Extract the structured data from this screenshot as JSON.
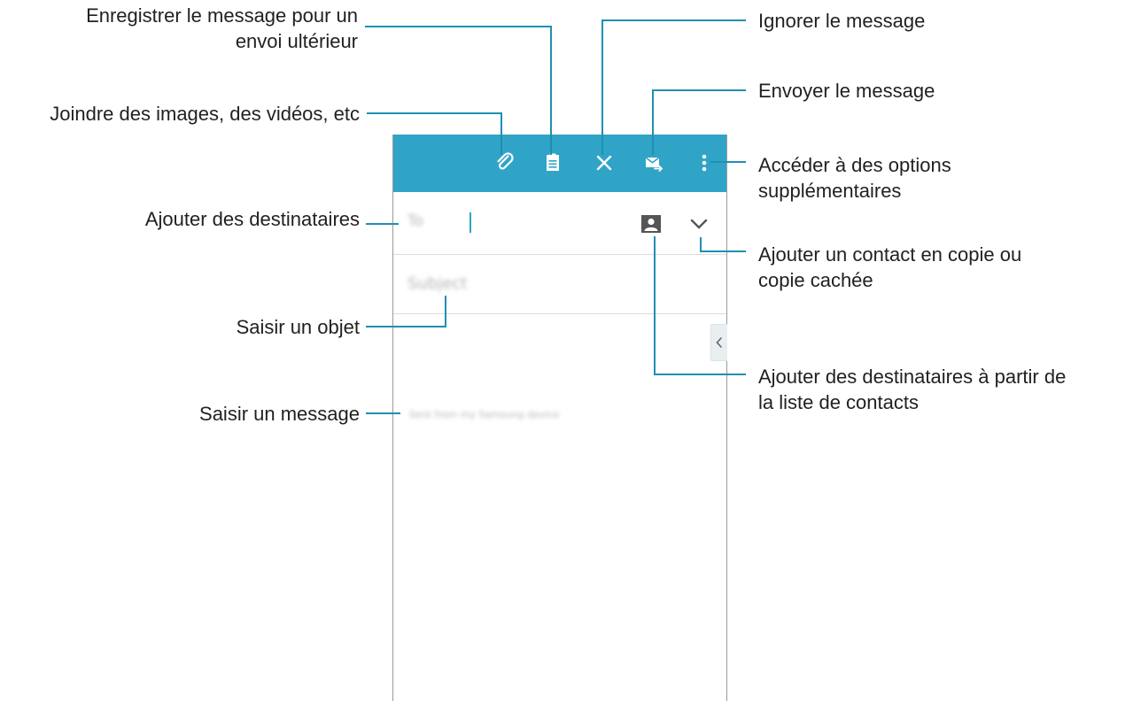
{
  "callouts": {
    "save_draft": [
      "Enregistrer le message pour un",
      "envoi ultérieur"
    ],
    "discard": "Ignorer le message",
    "send": "Envoyer le message",
    "attach": "Joindre des images, des vidéos, etc",
    "more_options": [
      "Accéder à des options",
      "supplémentaires"
    ],
    "add_recipients": "Ajouter des destinataires",
    "cc_bcc": [
      "Ajouter un contact en copie ou",
      "copie cachée"
    ],
    "subject": "Saisir un objet",
    "contacts_list": [
      "Ajouter des destinataires à partir de",
      "la liste de contacts"
    ],
    "message": "Saisir un message"
  },
  "composer": {
    "to_label": "To",
    "subject_placeholder": "Subject",
    "signature": "Sent from my Samsung device"
  },
  "colors": {
    "appbar": "#2fa4c6",
    "leader_line": "#1f8fb3",
    "text": "#231f20"
  },
  "icons": [
    "attach-icon",
    "save-draft-icon",
    "close-icon",
    "send-email-icon",
    "more-options-icon",
    "contact-icon",
    "chevron-down-icon",
    "chevron-left-icon"
  ]
}
